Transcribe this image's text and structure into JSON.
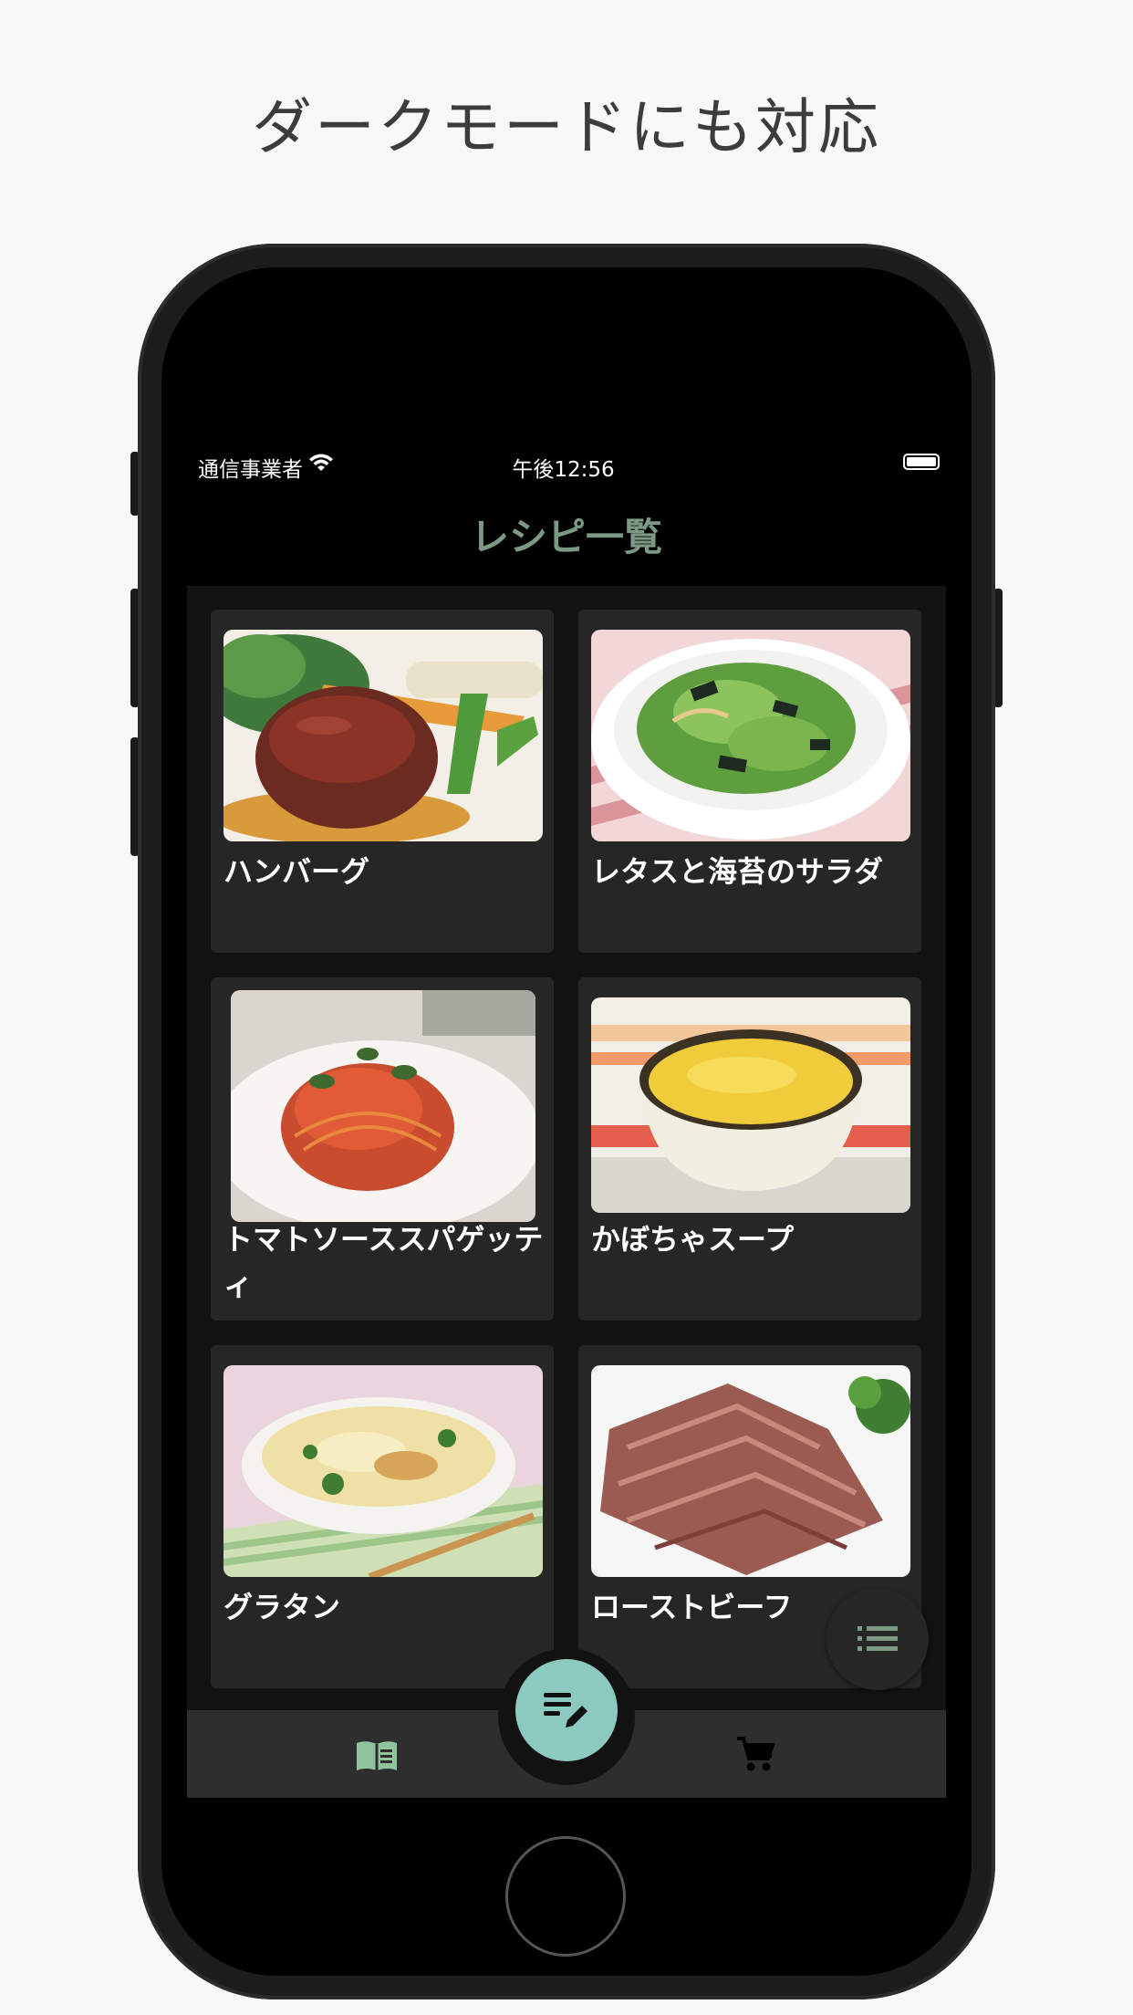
{
  "headline": "ダークモードにも対応",
  "status_bar": {
    "carrier": "通信事業者",
    "time": "午後12:56"
  },
  "nav": {
    "title": "レシピ一覧"
  },
  "recipes": [
    {
      "name": "ハンバーグ",
      "image": "hamburg-steak-photo"
    },
    {
      "name": "レタスと海苔のサラダ",
      "image": "lettuce-seaweed-salad-photo"
    },
    {
      "name": "トマトソーススパゲッティ",
      "image": "tomato-spaghetti-photo"
    },
    {
      "name": "かぼちゃスープ",
      "image": "pumpkin-soup-photo"
    },
    {
      "name": "グラタン",
      "image": "gratin-photo"
    },
    {
      "name": "ローストビーフ",
      "image": "roast-beef-photo"
    }
  ],
  "tabs": [
    {
      "icon": "recipe-book-icon",
      "active": true
    },
    {
      "icon": "shopping-cart-icon",
      "active": false
    }
  ],
  "fab_center_icon": "edit-list-icon",
  "fab_right_icon": "list-icon",
  "colors": {
    "accent": "#7c9a83",
    "fab": "#8cc9be",
    "card": "#262626",
    "background": "#121212"
  }
}
